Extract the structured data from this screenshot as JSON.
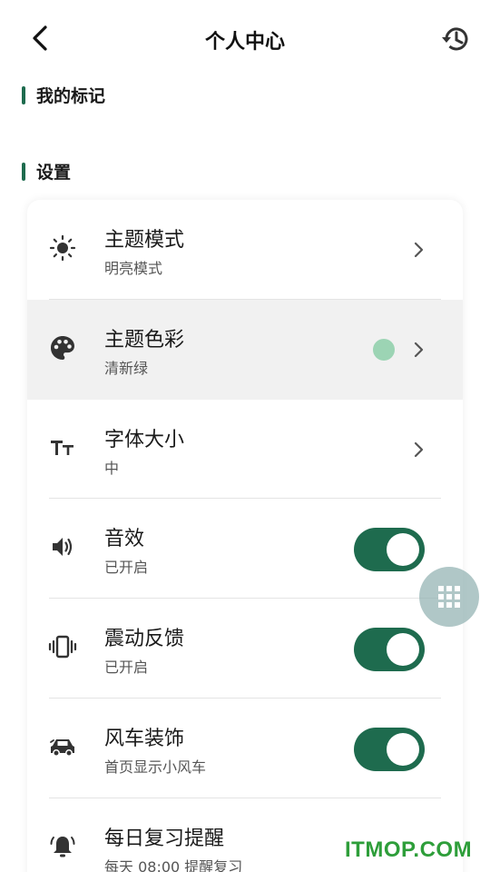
{
  "header": {
    "title": "个人中心"
  },
  "sections": {
    "marks": "我的标记",
    "settings": "设置"
  },
  "settings_items": [
    {
      "label": "主题模式",
      "value": "明亮模式",
      "icon": "sun-icon"
    },
    {
      "label": "主题色彩",
      "value": "清新绿",
      "icon": "palette-icon",
      "swatch_color": "#9cd4b4"
    },
    {
      "label": "字体大小",
      "value": "中",
      "icon": "text-size-icon"
    },
    {
      "label": "音效",
      "value": "已开启",
      "icon": "speaker-icon",
      "enabled": true
    },
    {
      "label": "震动反馈",
      "value": "已开启",
      "icon": "vibration-icon",
      "enabled": true
    },
    {
      "label": "风车装饰",
      "value": "首页显示小风车",
      "icon": "car-icon",
      "enabled": true
    },
    {
      "label": "每日复习提醒",
      "value": "每天 08:00 提醒复习",
      "icon": "alarm-bell-icon"
    }
  ],
  "colors": {
    "accent": "#1e6b4e",
    "highlight_row": "#f1f1f1"
  },
  "watermark": "ITMOP.COM"
}
